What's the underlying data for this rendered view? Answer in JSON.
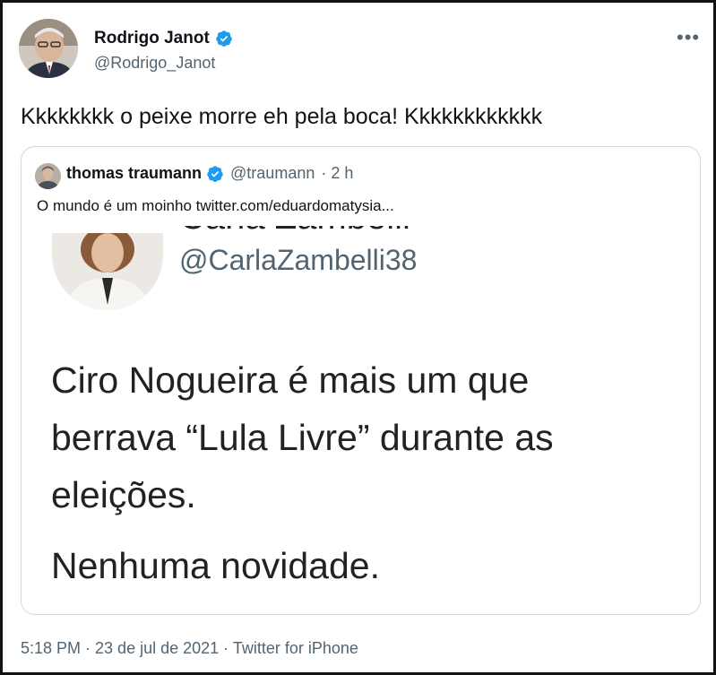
{
  "tweet": {
    "author_name": "Rodrigo Janot",
    "author_handle": "@Rodrigo_Janot",
    "text": "Kkkkkkkk o peixe morre eh pela boca! Kkkkkkkkkkkk",
    "more_icon": "more-horizontal-icon",
    "timestamp": "5:18 PM · 23 de jul de 2021 · Twitter for iPhone"
  },
  "quote": {
    "author_name": "thomas traumann",
    "author_handle": "@traumann",
    "time": "· 2 h",
    "text": "O mundo é um moinho  twitter.com/eduardomatysia...",
    "media": {
      "partial_name": "Carla Zambelli",
      "handle": "@CarlaZambelli38",
      "body_lines": [
        "Ciro Nogueira é mais um que",
        "berrava “Lula Livre” durante as",
        "eleições."
      ],
      "body_last": "Nenhuma novidade."
    }
  },
  "colors": {
    "verified_blue": "#1d9bf0",
    "secondary_text": "#536471",
    "border": "#cfd9de"
  }
}
